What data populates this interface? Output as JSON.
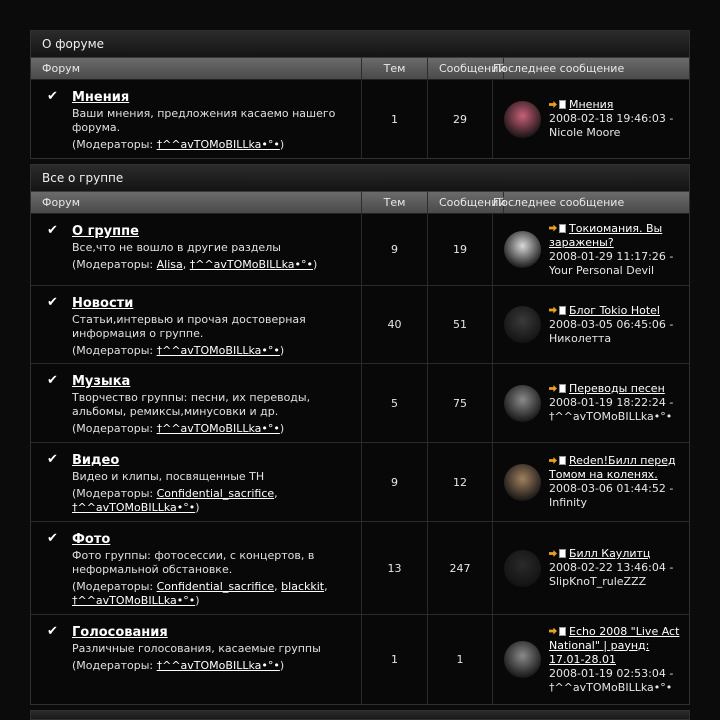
{
  "headers": {
    "forum": "Форум",
    "topics": "Тем",
    "posts": "Сообщений",
    "last": "Последнее сообщение"
  },
  "mod_prefix": "(Модераторы: ",
  "mod_suffix": ")",
  "categories": [
    {
      "title": "О форуме",
      "forums": [
        {
          "name": "Мнения",
          "desc": "Ваши мнения, предложения касаемо нашего форума.",
          "mods": [
            "†^^avTOMoBILLka•°•"
          ],
          "topics": "1",
          "posts": "29",
          "last": {
            "title": "Мнения",
            "date": "2008-02-18 19:46:03 -",
            "author": "Nicole Moore",
            "avatar_color": "#c86078"
          }
        }
      ]
    },
    {
      "title": "Все о группе",
      "forums": [
        {
          "name": "О группе",
          "desc": "Все,что не вошло в другие разделы",
          "mods": [
            "Alisa",
            "†^^avTOMoBILLka•°•"
          ],
          "topics": "9",
          "posts": "19",
          "last": {
            "title": "Токиомания. Вы заражены?",
            "date": "2008-01-29 11:17:26 -",
            "author": "Your Personal Devil",
            "avatar_color": "#d8d8d8"
          }
        },
        {
          "name": "Новости",
          "desc": "Статьи,интервью и прочая достоверная информация о группе.",
          "mods": [
            "†^^avTOMoBILLka•°•"
          ],
          "topics": "40",
          "posts": "51",
          "last": {
            "title": "Блог Tokio Hotel",
            "date": "2008-03-05 06:45:06 -",
            "author": "Николетта",
            "avatar_color": "#3a3a3a"
          }
        },
        {
          "name": "Музыка",
          "desc": "Творчество группы: песни, их переводы, альбомы, ремиксы,минусовки и др.",
          "mods": [
            "†^^avTOMoBILLka•°•"
          ],
          "topics": "5",
          "posts": "75",
          "last": {
            "title": "Переводы песен",
            "date": "2008-01-19 18:22:24 -",
            "author": "†^^avTOMoBILLka•°•",
            "avatar_color": "#8a8a8a"
          }
        },
        {
          "name": "Видео",
          "desc": "Видео и клипы, посвященные TH",
          "mods": [
            "Confidential_sacrifice",
            "†^^avTOMoBILLka•°•"
          ],
          "topics": "9",
          "posts": "12",
          "last": {
            "title": "Reden!Билл перед Томом на коленях.",
            "date": "2008-03-06 01:44:52 -",
            "author": "Infinity",
            "avatar_color": "#a08060"
          }
        },
        {
          "name": "Фото",
          "desc": "Фото группы: фотосессии, с концертов, в неформальной обстановке.",
          "mods": [
            "Confidential_sacrifice",
            "blackkit",
            "†^^avTOMoBILLka•°•"
          ],
          "topics": "13",
          "posts": "247",
          "last": {
            "title": "Билл Каулитц",
            "date": "2008-02-22 13:46:04 -",
            "author": "SlipKnoT_ruleZZZ",
            "avatar_color": "#2a2a2a"
          }
        },
        {
          "name": "Голосования",
          "desc": "Различные голосования, касаемые группы",
          "mods": [
            "†^^avTOMoBILLka•°•"
          ],
          "topics": "1",
          "posts": "1",
          "last": {
            "title": "Echo 2008 \"Live Act National\" | раунд: 17.01-28.01",
            "date": "2008-01-19 02:53:04 -",
            "author": "†^^avTOMoBILLka•°•",
            "avatar_color": "#8a8a8a"
          }
        }
      ]
    }
  ]
}
